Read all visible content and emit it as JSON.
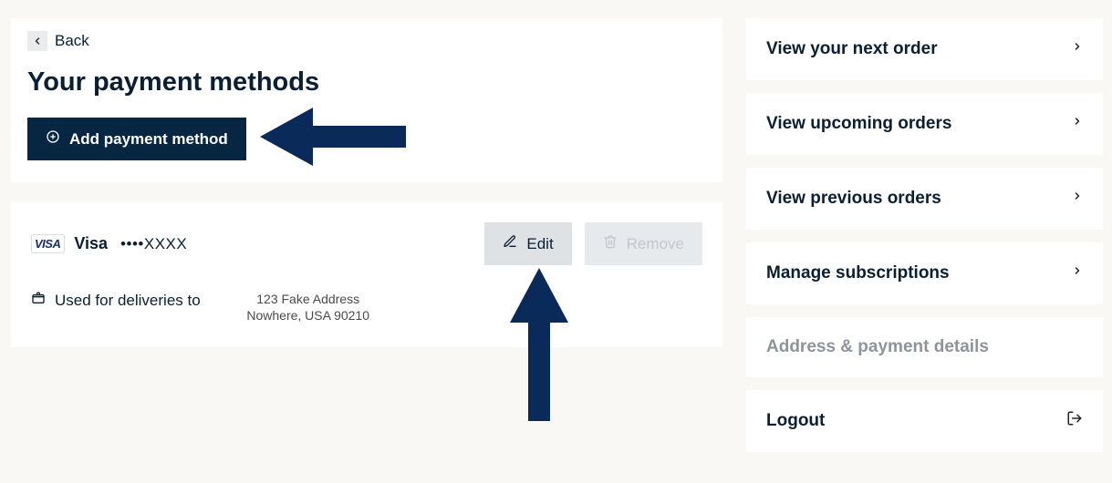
{
  "header": {
    "back_label": "Back",
    "title": "Your payment methods",
    "add_label": "Add payment method"
  },
  "card": {
    "brand": "Visa",
    "masked": "••••XXXX",
    "edit_label": "Edit",
    "remove_label": "Remove",
    "delivery_label": "Used for deliveries to",
    "address_line1": "123 Fake Address",
    "address_line2": "Nowhere, USA 90210"
  },
  "visa_word": "VISA",
  "sidebar": {
    "items": [
      {
        "label": "View your next order"
      },
      {
        "label": "View upcoming orders"
      },
      {
        "label": "View previous orders"
      },
      {
        "label": "Manage subscriptions"
      },
      {
        "label": "Address & payment details"
      },
      {
        "label": "Logout"
      }
    ]
  }
}
